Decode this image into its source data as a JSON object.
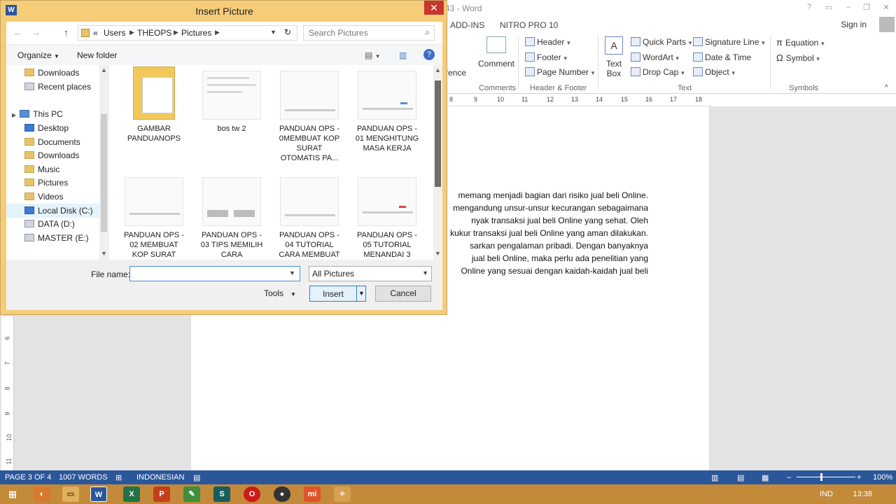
{
  "word": {
    "title": "43 - Word",
    "tabs": [
      "ADD-INS",
      "NITRO PRO 10"
    ],
    "sign_in": "Sign in",
    "ribbon": {
      "comment": "Comment",
      "comments_group": "Comments",
      "partial_left": "rence",
      "header": "Header",
      "footer": "Footer",
      "page_number": "Page Number",
      "header_footer_group": "Header & Footer",
      "text_box_1": "Text",
      "text_box_2": "Box",
      "quick_parts": "Quick Parts",
      "wordart": "WordArt",
      "drop_cap": "Drop Cap",
      "signature_line": "Signature Line",
      "date_time": "Date & Time",
      "object": "Object",
      "text_group": "Text",
      "equation": "Equation",
      "symbol": "Symbol",
      "symbols_group": "Symbols"
    },
    "ruler_numbers": [
      "8",
      "9",
      "10",
      "11",
      "12",
      "13",
      "14",
      "15",
      "16",
      "17",
      "18"
    ],
    "vruler_numbers": [
      "6",
      "7",
      "8",
      "9",
      "10",
      "11"
    ],
    "doc_lines": [
      "memang menjadi bagian dari risiko jual beli Online.",
      "mengandung unsur-unsur kecurangan sebagaimana",
      "nyak transaksi jual beli Online yang sehat. Oleh",
      "kukur transaksi jual beli Online yang aman dilakukan.",
      "sarkan pengalaman pribadi. Dengan banyaknya",
      "jual beli Online, maka perlu ada penelitian yang",
      "Online yang sesuai dengan kaidah-kaidah jual beli"
    ],
    "status": {
      "page": "PAGE 3 OF 4",
      "words": "1007 WORDS",
      "language": "INDONESIAN",
      "zoom": "100%"
    }
  },
  "taskbar": {
    "lang": "IND",
    "time": "13:38",
    "icons": [
      "W",
      "X",
      "P",
      "S",
      "mi"
    ]
  },
  "dialog": {
    "title": "Insert Picture",
    "breadcrumb": [
      "«",
      "Users",
      "THEOPS",
      "Pictures"
    ],
    "search_placeholder": "Search Pictures",
    "organize": "Organize",
    "new_folder": "New folder",
    "nav": {
      "downloads_top": "Downloads",
      "recent": "Recent places",
      "this_pc": "This PC",
      "desktop": "Desktop",
      "documents": "Documents",
      "downloads": "Downloads",
      "music": "Music",
      "pictures": "Pictures",
      "videos": "Videos",
      "local_disk": "Local Disk (C:)",
      "data": "DATA (D:)",
      "master": "MASTER (E:)"
    },
    "files": [
      {
        "line1": "GAMBAR",
        "line2": "PANDUANOPS",
        "line3": "",
        "line4": ""
      },
      {
        "line1": "bos tw 2",
        "line2": "",
        "line3": "",
        "line4": ""
      },
      {
        "line1": "PANDUAN OPS -",
        "line2": "0MEMBUAT KOP",
        "line3": "SURAT",
        "line4": "OTOMATIS PA..."
      },
      {
        "line1": "PANDUAN OPS -",
        "line2": "01 MENGHITUNG",
        "line3": "MASA KERJA",
        "line4": ""
      },
      {
        "line1": "PANDUAN OPS -",
        "line2": "02 MEMBUAT",
        "line3": "KOP SURAT",
        "line4": ""
      },
      {
        "line1": "PANDUAN OPS -",
        "line2": "03 TIPS MEMILIH",
        "line3": "CARA",
        "line4": ""
      },
      {
        "line1": "PANDUAN OPS -",
        "line2": "04 TUTORIAL",
        "line3": "CARA MEMBUAT",
        "line4": ""
      },
      {
        "line1": "PANDUAN OPS -",
        "line2": "05 TUTORIAL",
        "line3": "MENANDAI 3",
        "line4": ""
      }
    ],
    "file_name_label": "File name:",
    "file_name_value": "",
    "filter": "All Pictures",
    "tools": "Tools",
    "insert": "Insert",
    "cancel": "Cancel"
  }
}
